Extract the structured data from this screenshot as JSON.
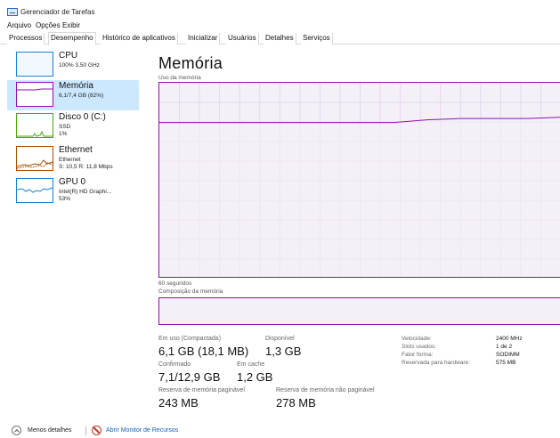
{
  "window": {
    "title": "Gerenciador de Tarefas"
  },
  "menu": [
    "Arquivo",
    "Opções",
    "Exibir"
  ],
  "tabs": [
    "Processos",
    "Desempenho",
    "Histórico de aplicativos",
    "Inicializar",
    "Usuários",
    "Detalhes",
    "Serviços"
  ],
  "active_tab": "Desempenho",
  "sidebar": [
    {
      "title": "CPU",
      "sub1": "100% 3,50 GHz",
      "sub2": "",
      "sub3": "",
      "color": "#1a7fd4"
    },
    {
      "title": "Memória",
      "sub1": "6,1/7,4 GB (82%)",
      "sub2": "",
      "sub3": "",
      "color": "#8b12ae",
      "active": true
    },
    {
      "title": "Disco 0 (C:)",
      "sub1": "SSD",
      "sub2": "1%",
      "sub3": "",
      "color": "#4da60c"
    },
    {
      "title": "Ethernet",
      "sub1": "Ethernet",
      "sub2": "S: 10,5 R: 11,8 Mbps",
      "sub3": "",
      "color": "#a74f01"
    },
    {
      "title": "GPU 0",
      "sub1": "Intel(R) HD Graphi...",
      "sub2": "53%",
      "sub3": "",
      "color": "#1a7fd4"
    }
  ],
  "main": {
    "title": "Memória",
    "usage_label": "Uso da memória",
    "time_label": "60 segundos",
    "composition_label": "Composição da memória"
  },
  "chart_data": {
    "type": "line",
    "x": [
      60,
      55,
      50,
      45,
      40,
      35,
      30,
      25,
      20,
      15,
      10,
      5,
      0
    ],
    "series": [
      {
        "values": [
          5.9,
          5.9,
          5.9,
          5.9,
          5.9,
          5.9,
          5.9,
          5.9,
          6.0,
          6.05,
          6.05,
          6.05,
          6.1
        ]
      }
    ],
    "ylim": [
      0,
      7.4
    ],
    "grid": true,
    "line_color": "#8b12ae",
    "fill_color": "#f5f0f7"
  },
  "stats": {
    "in_use_label": "Em uso (Compactada)",
    "in_use_value": "6,1 GB (18,1 MB)",
    "available_label": "Disponível",
    "available_value": "1,3 GB",
    "committed_label": "Confirmado",
    "committed_value": "7,1/12,9 GB",
    "cached_label": "Em cache",
    "cached_value": "1,2 GB",
    "paged_label": "Reserva de memória paginável",
    "paged_value": "243 MB",
    "nonpaged_label": "Reserva de memória não paginável",
    "nonpaged_value": "278 MB"
  },
  "specs": [
    {
      "label": "Velocidade:",
      "value": "2400 MHz"
    },
    {
      "label": "Slots usados:",
      "value": "1 de 2"
    },
    {
      "label": "Fator forma:",
      "value": "SODIMM"
    },
    {
      "label": "Reservada para hardware:",
      "value": "575 MB"
    }
  ],
  "bottom": {
    "less_details": "Menos detalhes",
    "resource_monitor": "Abrir Monitor de Recursos"
  }
}
